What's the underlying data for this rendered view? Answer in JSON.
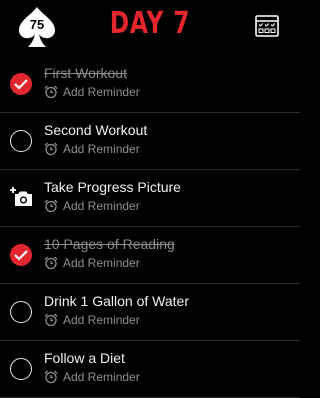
{
  "header": {
    "logo_text": "75",
    "day_label": "DAY  7",
    "accent_color": "#e3252e",
    "calendar_icon": "calendar-grid-icon"
  },
  "tasks": [
    {
      "label": "First Workout",
      "done": true,
      "reminder": "Add Reminder"
    },
    {
      "label": "Second Workout",
      "done": false,
      "reminder": "Add Reminder"
    },
    {
      "label": "Take Progress Picture",
      "done": false,
      "icon": "add-photo-icon",
      "reminder": "Add Reminder"
    },
    {
      "label": "10 Pages of Reading",
      "done": true,
      "reminder": "Add Reminder"
    },
    {
      "label": "Drink 1 Gallon of Water",
      "done": false,
      "reminder": "Add Reminder"
    },
    {
      "label": "Follow a Diet",
      "done": false,
      "reminder": "Add Reminder"
    }
  ]
}
